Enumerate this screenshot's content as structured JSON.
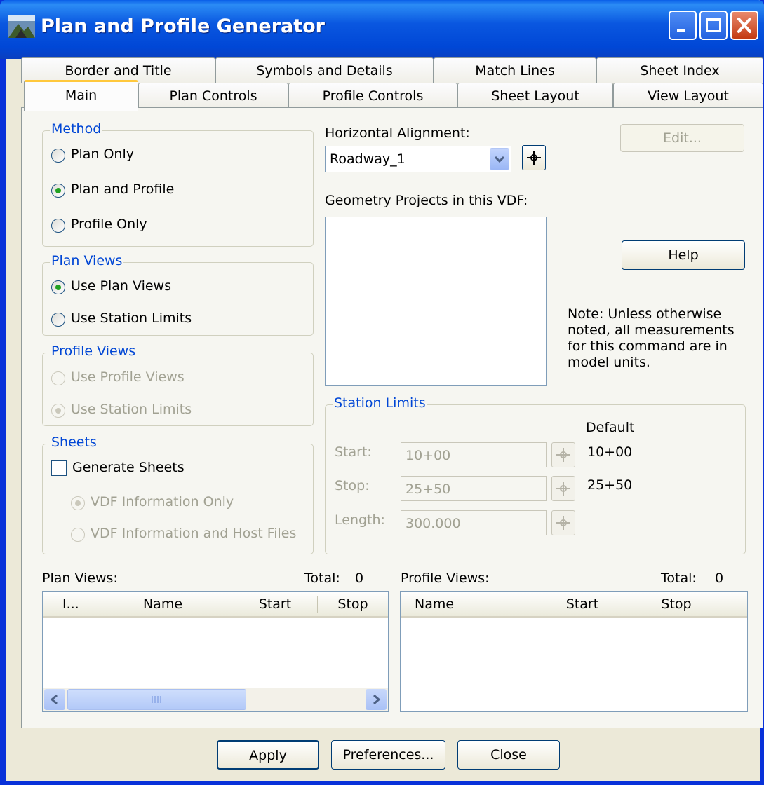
{
  "window": {
    "title": "Plan and Profile Generator"
  },
  "tabs": {
    "back_row": [
      "Border and Title",
      "Symbols and Details",
      "Match Lines",
      "Sheet Index"
    ],
    "front_row": [
      "Main",
      "Plan Controls",
      "Profile Controls",
      "Sheet Layout",
      "View Layout"
    ],
    "active": "Main"
  },
  "method": {
    "legend": "Method",
    "options": [
      "Plan Only",
      "Plan and Profile",
      "Profile Only"
    ],
    "selected": "Plan and Profile"
  },
  "plan_views": {
    "legend": "Plan Views",
    "options": [
      "Use Plan Views",
      "Use Station Limits"
    ],
    "selected": "Use Plan Views"
  },
  "profile_views": {
    "legend": "Profile Views",
    "options": [
      "Use Profile Views",
      "Use Station Limits"
    ],
    "selected": "Use Station Limits"
  },
  "sheets": {
    "legend": "Sheets",
    "generate_label": "Generate Sheets",
    "generate_checked": false,
    "options": [
      "VDF Information Only",
      "VDF Information and Host Files"
    ],
    "selected": "VDF Information Only"
  },
  "alignment": {
    "label": "Horizontal Alignment:",
    "value": "Roadway_1",
    "edit_label": "Edit...",
    "geometry_label": "Geometry Projects in this VDF:"
  },
  "help_label": "Help",
  "note": [
    "Note:  Unless otherwise",
    "noted, all measurements",
    "for this command are in",
    "model units."
  ],
  "station_limits": {
    "legend": "Station Limits",
    "default_header": "Default",
    "rows": [
      {
        "label": "Start:",
        "value": "10+00",
        "default": "10+00"
      },
      {
        "label": "Stop:",
        "value": "25+50",
        "default": "25+50"
      },
      {
        "label": "Length:",
        "value": "300.000",
        "default": ""
      }
    ]
  },
  "plan_list": {
    "label": "Plan Views:",
    "total_label": "Total:",
    "total": "0",
    "columns": [
      "I...",
      "Name",
      "Start",
      "Stop"
    ]
  },
  "profile_list": {
    "label": "Profile Views:",
    "total_label": "Total:",
    "total": "0",
    "columns": [
      "Name",
      "Start",
      "Stop"
    ]
  },
  "footer": {
    "apply": "Apply",
    "preferences": "Preferences...",
    "close": "Close"
  },
  "colors": {
    "title_bar": "#0a57e0",
    "group_legend": "#0046d5",
    "active_tab_accent": "#ffc83c"
  }
}
